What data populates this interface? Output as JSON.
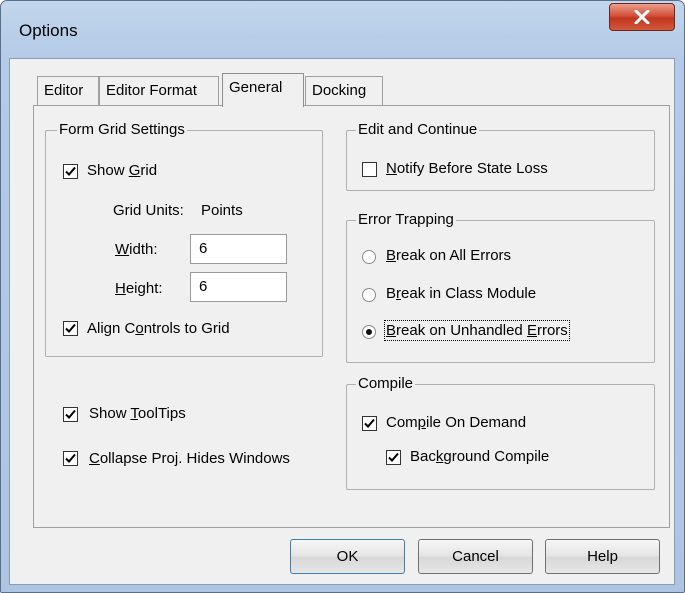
{
  "window": {
    "title": "Options"
  },
  "tabs": [
    {
      "label": "Editor",
      "active": false
    },
    {
      "label": "Editor Format",
      "active": false
    },
    {
      "label": "General",
      "active": true
    },
    {
      "label": "Docking",
      "active": false
    }
  ],
  "form_grid": {
    "legend": "Form Grid Settings",
    "show_grid": {
      "pre": "Show ",
      "key": "G",
      "post": "rid",
      "checked": true
    },
    "grid_units": {
      "label": "Grid Units:",
      "value": "Points"
    },
    "width": {
      "pre": "",
      "key": "W",
      "post": "idth:",
      "value": "6"
    },
    "height": {
      "pre": "",
      "key": "H",
      "post": "eight:",
      "value": "6"
    },
    "align": {
      "pre": "Align C",
      "key": "o",
      "post": "ntrols to Grid",
      "checked": true
    }
  },
  "misc": {
    "show_tooltips": {
      "pre": "Show ",
      "key": "T",
      "post": "oolTips",
      "checked": true
    },
    "collapse": {
      "pre": "",
      "key": "C",
      "post": "ollapse Proj. Hides Windows",
      "checked": true
    }
  },
  "edit_continue": {
    "legend": "Edit and Continue",
    "notify": {
      "pre": "",
      "key": "N",
      "post": "otify Before State Loss",
      "checked": false
    }
  },
  "error_trapping": {
    "legend": "Error Trapping",
    "options": [
      {
        "pre": "",
        "key": "B",
        "post": "reak on All Errors",
        "selected": false
      },
      {
        "pre": "B",
        "key": "r",
        "post": "eak in Class Module",
        "selected": false
      },
      {
        "pre": "",
        "key": "B",
        "post": "reak on Unhandled ",
        "key2": "E",
        "post2": "rrors",
        "selected": true
      }
    ]
  },
  "compile": {
    "legend": "Compile",
    "on_demand": {
      "pre": "Com",
      "key": "p",
      "post": "ile On Demand",
      "checked": true
    },
    "background": {
      "pre": "Bac",
      "key": "k",
      "post": "ground Compile",
      "checked": true
    }
  },
  "buttons": {
    "ok": "OK",
    "cancel": "Cancel",
    "help": "Help"
  },
  "icons": {
    "check": "check-icon",
    "close": "close-icon"
  }
}
